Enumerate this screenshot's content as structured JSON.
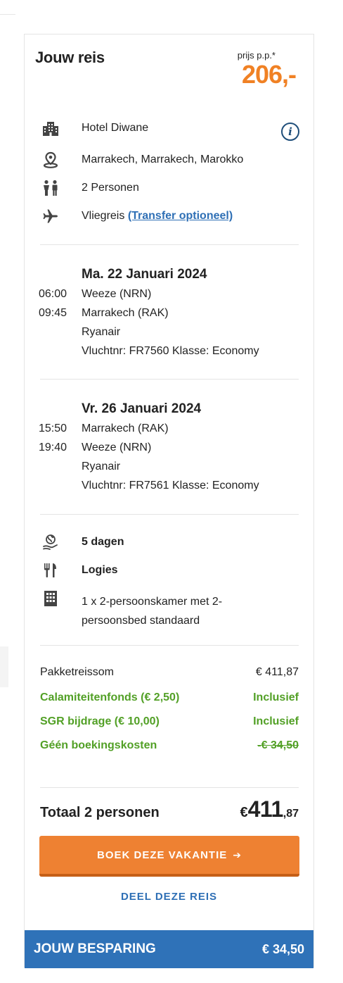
{
  "header": {
    "title": "Jouw reis",
    "price_label": "prijs p.p.*",
    "price_value": "206,-"
  },
  "trip": {
    "hotel": "Hotel Diwane",
    "location": "Marrakech, Marrakech, Marokko",
    "persons": "2 Personen",
    "travel_type": "Vliegreis",
    "transfer_link": "(Transfer optioneel)"
  },
  "outbound": {
    "date": "Ma. 22 Januari 2024",
    "dep_time": "06:00",
    "dep_airport": "Weeze (NRN)",
    "arr_time": "09:45",
    "arr_airport": "Marrakech (RAK)",
    "airline": "Ryanair",
    "flight_info": "Vluchtnr: FR7560  Klasse: Economy"
  },
  "return": {
    "date": "Vr. 26 Januari 2024",
    "dep_time": "15:50",
    "dep_airport": "Marrakech (RAK)",
    "arr_time": "19:40",
    "arr_airport": "Weeze (NRN)",
    "airline": "Ryanair",
    "flight_info": "Vluchtnr: FR7561  Klasse: Economy"
  },
  "stay": {
    "duration": "5 dagen",
    "board": "Logies",
    "room": "1 x 2-persoonskamer met 2-persoonsbed standaard"
  },
  "summary": {
    "package_label": "Pakketreissom",
    "package_value": "€ 411,87",
    "calamity_label": "Calamiteitenfonds (€ 2,50)",
    "calamity_value": "Inclusief",
    "sgr_label": "SGR bijdrage (€ 10,00)",
    "sgr_value": "Inclusief",
    "booking_label": "Géén boekingskosten",
    "booking_value": "-€ 34,50"
  },
  "total": {
    "label": "Totaal 2 personen",
    "currency": "€",
    "integer": "411",
    "decimals": ",87"
  },
  "actions": {
    "book_label": "BOEK DEZE VAKANTIE",
    "share_label": "DEEL DEZE REIS"
  },
  "savings": {
    "label": "JOUW BESPARING",
    "value": "€ 34,50"
  },
  "icons": {
    "hotel": "hotel-building-icon",
    "location": "map-pin-icon",
    "persons": "people-icon",
    "flight": "airplane-icon",
    "info": "info-icon",
    "duration": "globe-hand-icon",
    "board": "fork-knife-icon",
    "room": "building-icon",
    "arrow": "arrow-right-icon"
  },
  "colors": {
    "accent_orange": "#f08124",
    "link_blue": "#2e6fb5",
    "green": "#52a026",
    "savings_bar": "#2f72b8"
  }
}
